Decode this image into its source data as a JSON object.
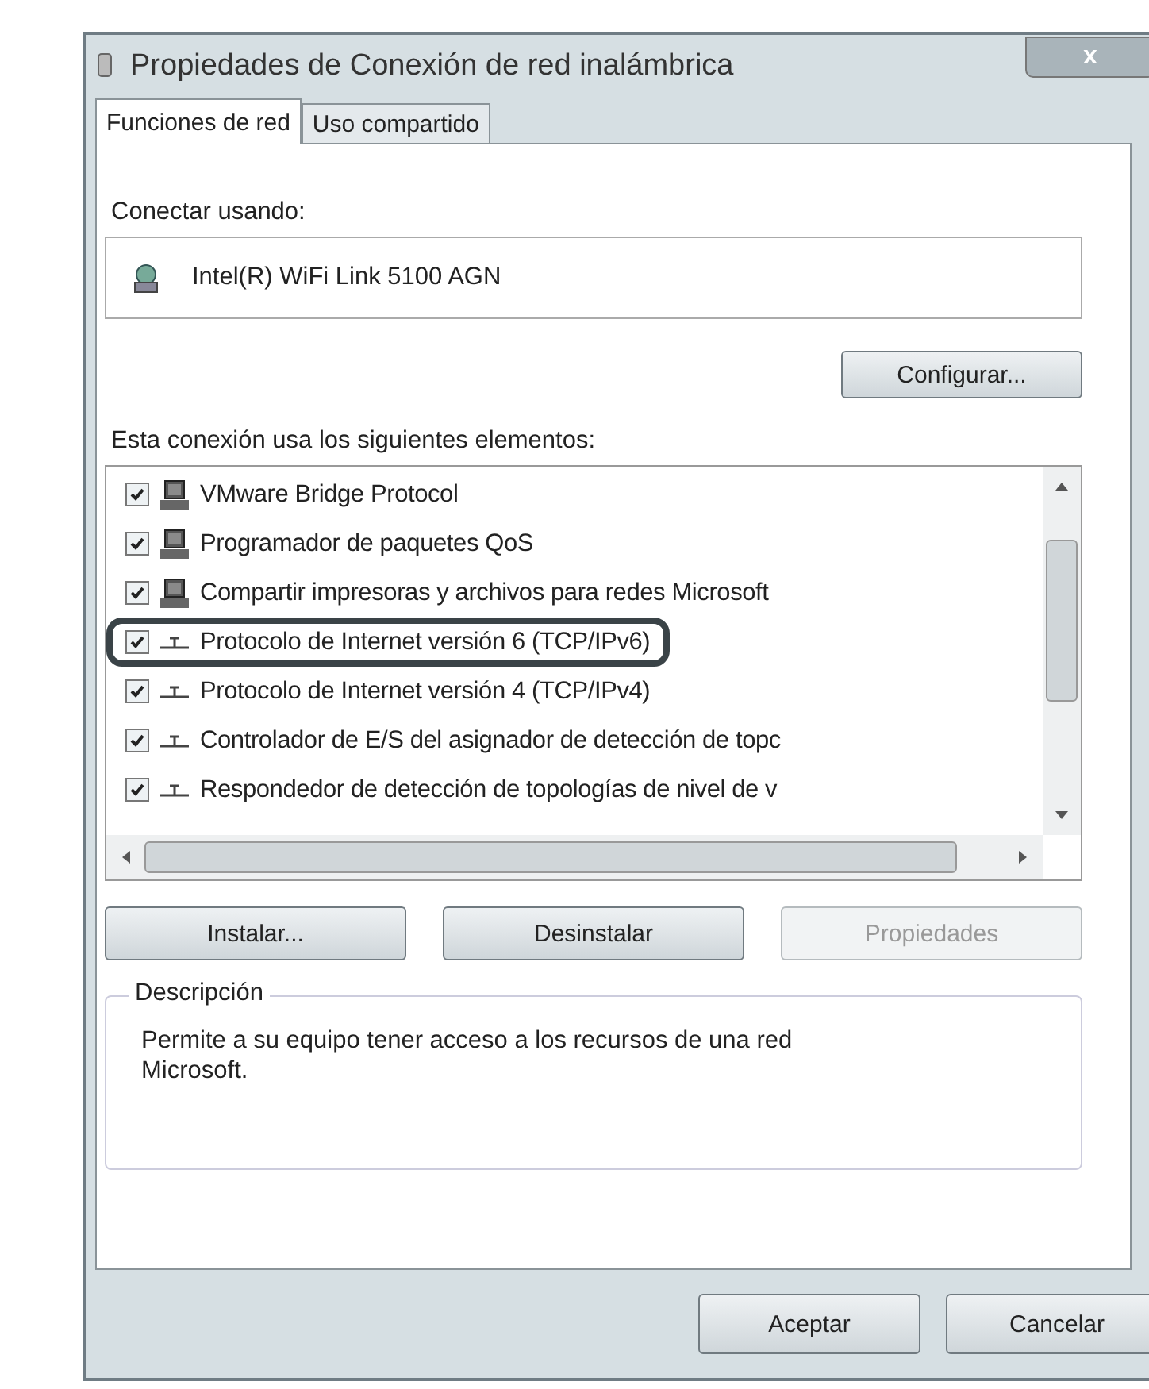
{
  "window": {
    "title": "Propiedades de Conexión de red inalámbrica",
    "close": "x"
  },
  "tabs": [
    {
      "label": "Funciones de red",
      "selected": true
    },
    {
      "label": "Uso compartido",
      "selected": false
    }
  ],
  "connect": {
    "label": "Conectar usando:",
    "adapter": "Intel(R) WiFi Link 5100 AGN",
    "button": "Configurar..."
  },
  "components": {
    "label": "Esta conexión usa los siguientes elementos:",
    "items": [
      {
        "label": "VMware Bridge Protocol",
        "kind": "computer",
        "checked": true,
        "circled": false
      },
      {
        "label": "Programador de paquetes QoS",
        "kind": "computer",
        "checked": true,
        "circled": false
      },
      {
        "label": "Compartir impresoras y archivos para redes Microsoft",
        "kind": "computer",
        "checked": true,
        "circled": false
      },
      {
        "label": "Protocolo de Internet versión 6 (TCP/IPv6)",
        "kind": "protocol",
        "checked": true,
        "circled": true
      },
      {
        "label": "Protocolo de Internet versión 4 (TCP/IPv4)",
        "kind": "protocol",
        "checked": true,
        "circled": false
      },
      {
        "label": "Controlador de E/S del asignador de detección de topc",
        "kind": "protocol",
        "checked": true,
        "circled": false
      },
      {
        "label": "Respondedor de detección de topologías de nivel de v",
        "kind": "protocol",
        "checked": true,
        "circled": false
      }
    ]
  },
  "actions": [
    {
      "label": "Instalar...",
      "disabled": false
    },
    {
      "label": "Desinstalar",
      "disabled": false
    },
    {
      "label": "Propiedades",
      "disabled": true
    }
  ],
  "description": {
    "title": "Descripción",
    "text": "Permite a su equipo tener acceso a los recursos de una red Microsoft."
  },
  "buttons": [
    "Aceptar",
    "Cancelar"
  ]
}
